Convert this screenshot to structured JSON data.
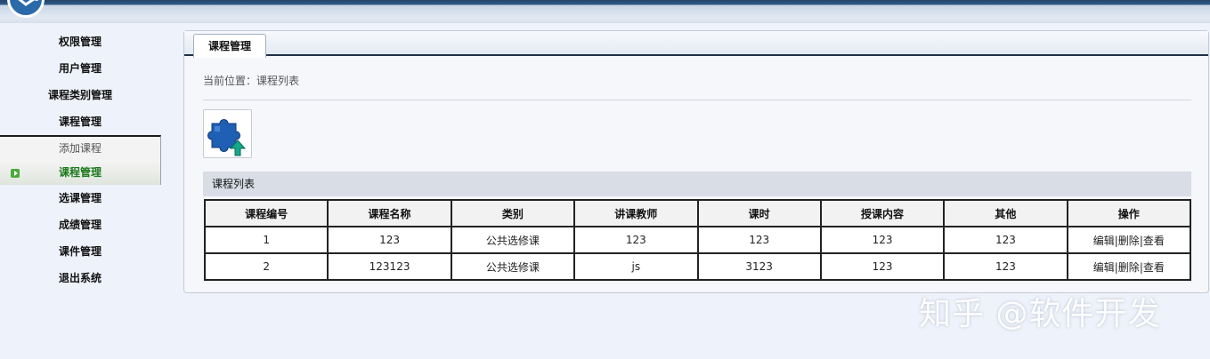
{
  "sidebar": {
    "items": [
      "权限管理",
      "用户管理",
      "课程类别管理",
      "课程管理"
    ],
    "sub_items": [
      "添加课程",
      "课程管理"
    ],
    "items_after": [
      "选课管理",
      "成绩管理",
      "课件管理",
      "退出系统"
    ]
  },
  "panel": {
    "tab_label": "课程管理",
    "breadcrumb": "当前位置：课程列表",
    "list_title": "课程列表",
    "add_icon": "puzzle-upload-icon"
  },
  "table": {
    "columns": [
      "课程编号",
      "课程名称",
      "类别",
      "讲课教师",
      "课时",
      "授课内容",
      "其他",
      "操作"
    ],
    "rows": [
      [
        "1",
        "123",
        "公共选修课",
        "123",
        "123",
        "123",
        "123"
      ],
      [
        "2",
        "123123",
        "公共选修课",
        "js",
        "3123",
        "123",
        "123"
      ]
    ],
    "actions": [
      "编辑",
      "删除",
      "查看"
    ],
    "separator": "|"
  },
  "watermark": "知乎 @软件开发",
  "colors": {
    "accent_green": "#1d7a1d",
    "header_blue": "#2c5a86",
    "tab_underline": "#1f3147"
  }
}
